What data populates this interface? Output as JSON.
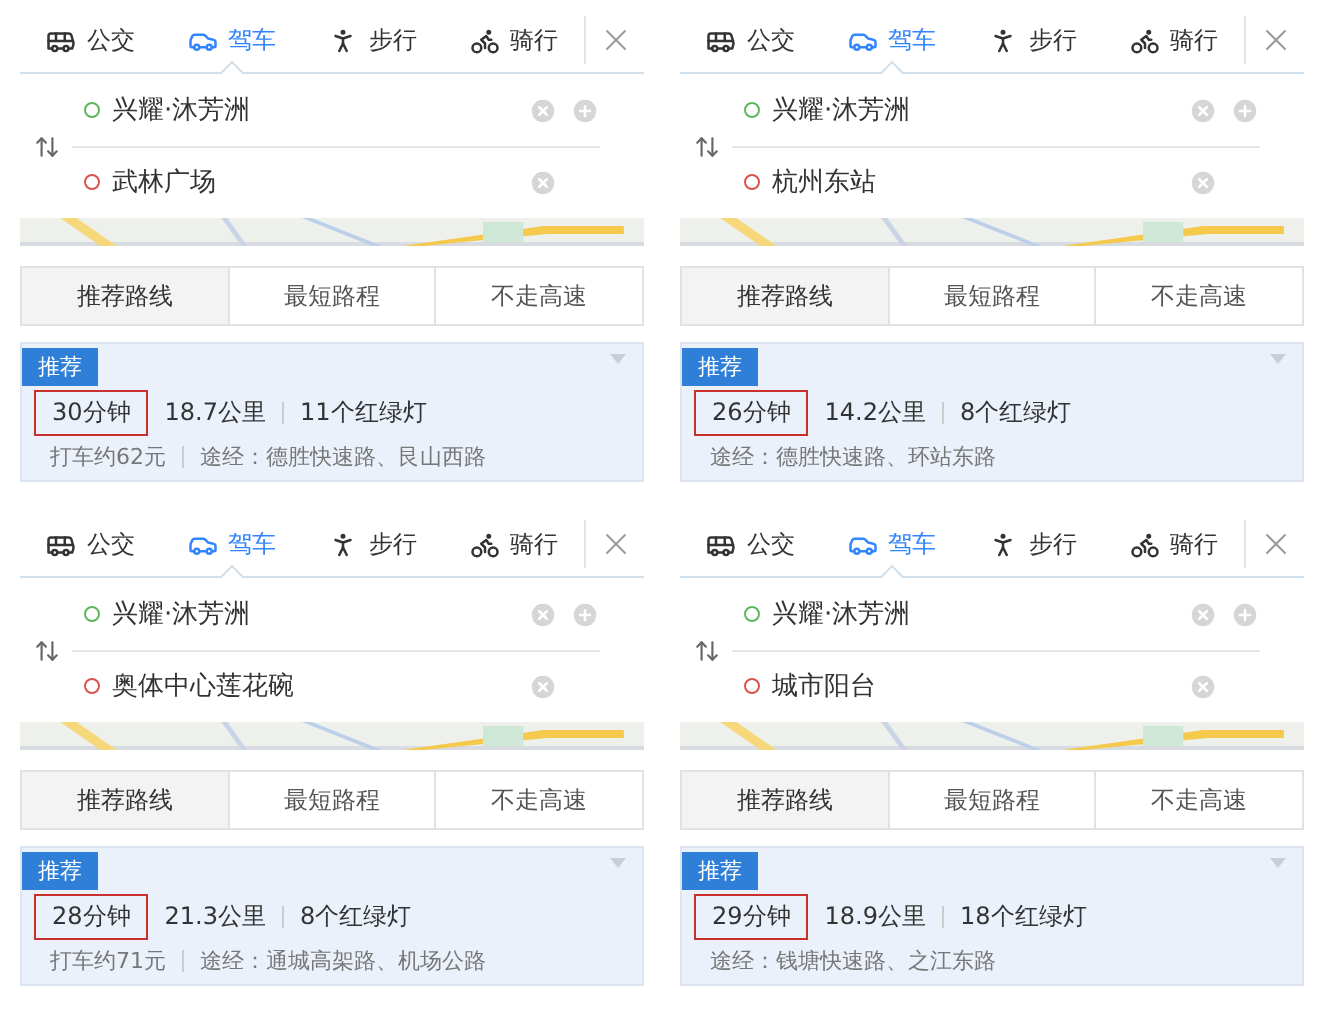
{
  "panels": [
    {
      "modes": [
        {
          "label": "公交",
          "kind": "bus",
          "selected": false
        },
        {
          "label": "驾车",
          "kind": "car",
          "selected": true
        },
        {
          "label": "步行",
          "kind": "walk",
          "selected": false
        },
        {
          "label": "骑行",
          "kind": "bike",
          "selected": false
        }
      ],
      "waypoints": [
        {
          "kind": "start",
          "name": "兴耀·沐芳洲",
          "color": "#5cb85c"
        },
        {
          "kind": "end",
          "name": "武林广场",
          "color": "#d9534f"
        }
      ],
      "route_options": [
        {
          "label": "推荐路线",
          "selected": true
        },
        {
          "label": "最短路程",
          "selected": false
        },
        {
          "label": "不走高速",
          "selected": false
        }
      ],
      "route": {
        "badge": "推荐",
        "time": "30分钟",
        "time_highlighted": true,
        "distance": "18.7公里",
        "lights": "11个红绿灯",
        "taxi": "打车约62元",
        "via": "途经：德胜快速路、艮山西路"
      }
    },
    {
      "modes": [
        {
          "label": "公交",
          "kind": "bus",
          "selected": false
        },
        {
          "label": "驾车",
          "kind": "car",
          "selected": true
        },
        {
          "label": "步行",
          "kind": "walk",
          "selected": false
        },
        {
          "label": "骑行",
          "kind": "bike",
          "selected": false
        }
      ],
      "waypoints": [
        {
          "kind": "start",
          "name": "兴耀·沐芳洲",
          "color": "#5cb85c"
        },
        {
          "kind": "end",
          "name": "杭州东站",
          "color": "#d9534f"
        }
      ],
      "route_options": [
        {
          "label": "推荐路线",
          "selected": true
        },
        {
          "label": "最短路程",
          "selected": false
        },
        {
          "label": "不走高速",
          "selected": false
        }
      ],
      "route": {
        "badge": "推荐",
        "time": "26分钟",
        "time_highlighted": true,
        "distance": "14.2公里",
        "lights": "8个红绿灯",
        "via": "途经：德胜快速路、环站东路"
      }
    },
    {
      "modes": [
        {
          "label": "公交",
          "kind": "bus",
          "selected": false
        },
        {
          "label": "驾车",
          "kind": "car",
          "selected": true
        },
        {
          "label": "步行",
          "kind": "walk",
          "selected": false
        },
        {
          "label": "骑行",
          "kind": "bike",
          "selected": false
        }
      ],
      "waypoints": [
        {
          "kind": "start",
          "name": "兴耀·沐芳洲",
          "color": "#5cb85c"
        },
        {
          "kind": "end",
          "name": "奥体中心莲花碗",
          "color": "#d9534f"
        }
      ],
      "route_options": [
        {
          "label": "推荐路线",
          "selected": true
        },
        {
          "label": "最短路程",
          "selected": false
        },
        {
          "label": "不走高速",
          "selected": false
        }
      ],
      "route": {
        "badge": "推荐",
        "time": "28分钟",
        "time_highlighted": true,
        "distance": "21.3公里",
        "lights": "8个红绿灯",
        "taxi": "打车约71元",
        "via": "途经：通城高架路、机场公路"
      }
    },
    {
      "modes": [
        {
          "label": "公交",
          "kind": "bus",
          "selected": false
        },
        {
          "label": "驾车",
          "kind": "car",
          "selected": true
        },
        {
          "label": "步行",
          "kind": "walk",
          "selected": false
        },
        {
          "label": "骑行",
          "kind": "bike",
          "selected": false
        }
      ],
      "waypoints": [
        {
          "kind": "start",
          "name": "兴耀·沐芳洲",
          "color": "#5cb85c"
        },
        {
          "kind": "end",
          "name": "城市阳台",
          "color": "#d9534f"
        }
      ],
      "route_options": [
        {
          "label": "推荐路线",
          "selected": true
        },
        {
          "label": "最短路程",
          "selected": false
        },
        {
          "label": "不走高速",
          "selected": false
        }
      ],
      "route": {
        "badge": "推荐",
        "time": "29分钟",
        "time_highlighted": true,
        "distance": "18.9公里",
        "lights": "18个红绿灯",
        "via": "途经：钱塘快速路、之江东路"
      }
    }
  ]
}
